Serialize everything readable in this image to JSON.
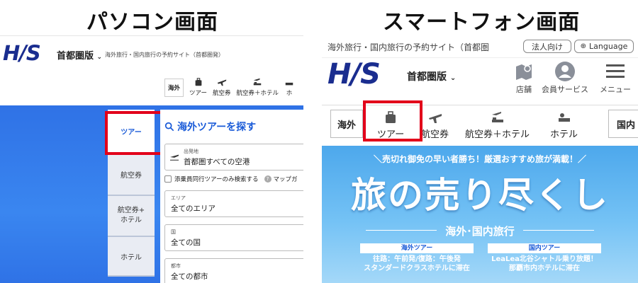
{
  "pc": {
    "panel_title": "パソコン画面",
    "logo": "H/S",
    "region": "首都圏版",
    "tagline": "海外旅行・国内旅行の予約サイト（首都圏発）",
    "nav": [
      {
        "label": "海外"
      },
      {
        "label": "ツアー",
        "icon": "suitcase-icon"
      },
      {
        "label": "航空券",
        "icon": "airplane-icon"
      },
      {
        "label": "航空券＋ホテル",
        "icon": "plane-bed-icon"
      },
      {
        "label": "ホ"
      }
    ],
    "side_tabs": [
      "ツアー",
      "航空券",
      "航空券+\nホテル",
      "ホテル"
    ],
    "search_title": "海外ツアーを探す",
    "departure": {
      "label": "出発地",
      "value": "首都圏すべての空港"
    },
    "checkbox_label": "添乗員同行ツアーのみ検索する",
    "checkbox_help": "?",
    "map_link": "マップガ",
    "area": {
      "label": "エリア",
      "value": "全てのエリア"
    },
    "country": {
      "label": "国",
      "value": "全ての国"
    },
    "city": {
      "label": "都市",
      "value": "全ての都市"
    }
  },
  "sp": {
    "panel_title": "スマートフォン画面",
    "tagline": "海外旅行・国内旅行の予約サイト（首都圏",
    "corporate": "法人向け",
    "language": "Language",
    "logo": "H/S",
    "region": "首都圏版",
    "icons": [
      {
        "label": "店舗",
        "icon": "store-map-icon"
      },
      {
        "label": "会員サービス",
        "icon": "member-icon"
      },
      {
        "label": "メニュー",
        "icon": "menu-icon"
      }
    ],
    "nav": {
      "overseas": "海外",
      "tour": "ツアー",
      "flight": "航空券",
      "flight_hotel": "航空券＋ホテル",
      "hotel": "ホテル",
      "domestic": "国内"
    },
    "banner": {
      "sub": "＼売切れ御免の早い者勝ち！厳選おすすめ旅が満載！／",
      "main": "旅の売り尽くし",
      "region": "海外･国内旅行",
      "left_badge": "海外ツアー",
      "left_line1": "往路：午前発/復路：午後発",
      "left_line2": "スタンダードクラスホテルに滞在",
      "right_badge": "国内ツアー",
      "right_line1": "LeaLea北谷シャトル乗り放題！",
      "right_line2": "那覇市内ホテルに滞在"
    }
  },
  "colors": {
    "brand": "#1a2d8f",
    "highlight": "#e2001a",
    "accent": "#1a5bd8"
  }
}
